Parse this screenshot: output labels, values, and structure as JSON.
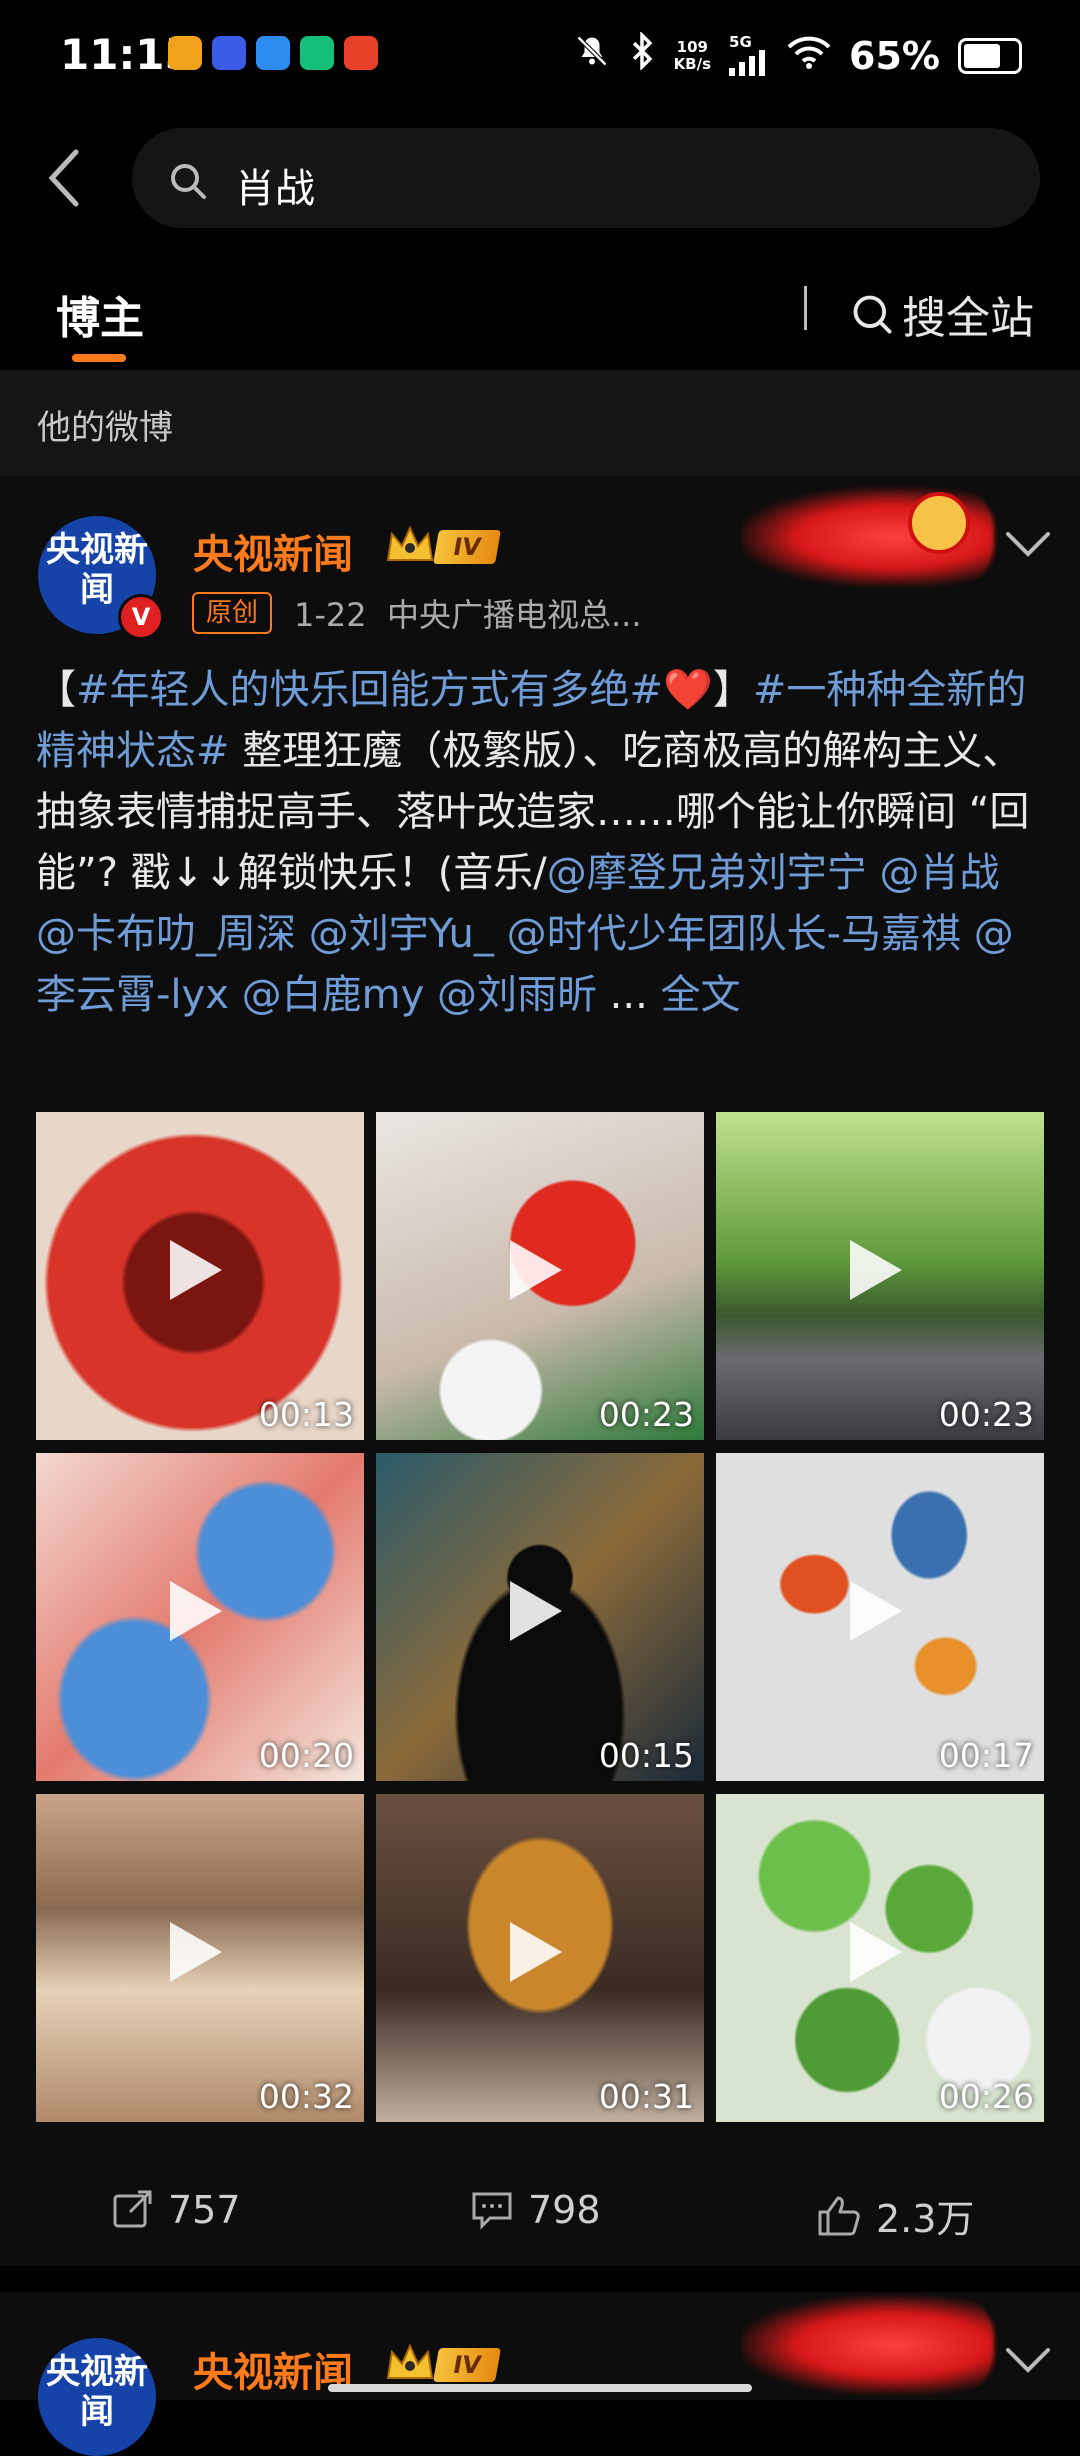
{
  "status_bar": {
    "time": "11:15",
    "net_speed_value": "109",
    "net_speed_unit": "KB/s",
    "signal": "5G",
    "battery": "65%",
    "app_icon_colors": [
      "#f2a21a",
      "#3a5ce6",
      "#2d8cf0",
      "#17c07a",
      "#e8402a"
    ]
  },
  "search": {
    "query": "肖战"
  },
  "tabs": {
    "active": "博主",
    "search_all": "搜全站"
  },
  "section": {
    "title": "他的微博"
  },
  "post": {
    "author": "央视新闻",
    "avatar_text": "央视新闻",
    "verified": "V",
    "level": "IV",
    "original_label": "原创",
    "date": "1-22",
    "source": "中央广播电视总...",
    "text": {
      "p1": "【",
      "tag1": "#年轻人的快乐回能方式有多绝#",
      "heart": "❤️",
      "p2": "】",
      "tag2": "#一种种全新的精神状态#",
      "p3": " 整理狂魔（极繁版）、吃商极高的解构主义、抽象表情捕捉高手、落叶改造家……哪个能让你瞬间 “回能”? 戳↓↓解锁快乐！(音乐/",
      "mentions": "@摩登兄弟刘宇宁 @肖战 @卡布叻_周深 @刘宇Yu_ @时代少年团队长-马嘉祺 @李云霄-lyx @白鹿my @刘雨昕",
      "ellipsis": " ... ",
      "more": "全文"
    },
    "videos": [
      {
        "duration": "00:13"
      },
      {
        "duration": "00:23"
      },
      {
        "duration": "00:23"
      },
      {
        "duration": "00:20"
      },
      {
        "duration": "00:15"
      },
      {
        "duration": "00:17"
      },
      {
        "duration": "00:32"
      },
      {
        "duration": "00:31"
      },
      {
        "duration": "00:26"
      }
    ],
    "actions": {
      "reposts": "757",
      "comments": "798",
      "likes": "2.3万"
    }
  },
  "next_post": {
    "author": "央视新闻",
    "avatar_text": "央视新闻",
    "level": "IV"
  }
}
